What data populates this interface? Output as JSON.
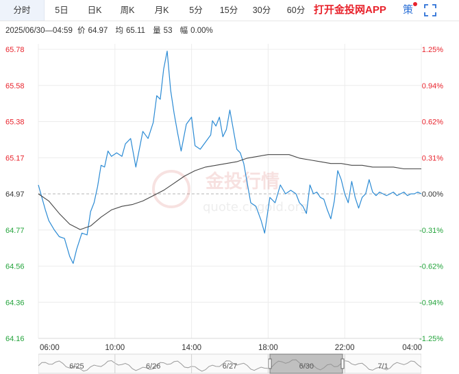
{
  "tabs": [
    "分时",
    "5日",
    "日K",
    "周K",
    "月K",
    "5分",
    "15分",
    "30分",
    "60分"
  ],
  "active_tab": "分时",
  "promo_text": "打开金投网APP",
  "strategy_label": "策",
  "info": {
    "datetime": "2025/06/30—04:59",
    "price_label": "价",
    "price": "64.97",
    "avg_label": "均",
    "avg": "65.11",
    "vol_label": "量",
    "vol": "53",
    "chg_label": "幅",
    "chg": "0.00%"
  },
  "watermark": {
    "text": "金投行情",
    "url": "quote.cngold.org"
  },
  "colors": {
    "up": "#e8222b",
    "down": "#22a33a",
    "flat": "#333333",
    "price_line": "#2a8ad4",
    "avg_line": "#444444"
  },
  "chart_data": {
    "type": "line",
    "title": "",
    "x_ticks": [
      "06:00",
      "10:00",
      "14:00",
      "18:00",
      "22:00",
      "04:00"
    ],
    "y_left_ticks": [
      "65.78",
      "65.58",
      "65.38",
      "65.17",
      "64.97",
      "64.77",
      "64.56",
      "64.36",
      "64.16"
    ],
    "y_right_ticks": [
      "1.25%",
      "0.94%",
      "0.62%",
      "0.31%",
      "0.00%",
      "-0.31%",
      "-0.62%",
      "-0.94%",
      "-1.25%"
    ],
    "ylim": [
      64.16,
      65.78
    ],
    "xlim_hours": [
      0,
      22
    ],
    "prev_close": 64.97,
    "series": [
      {
        "name": "价",
        "x": [
          0,
          0.2,
          0.4,
          0.6,
          0.9,
          1.2,
          1.5,
          1.8,
          2.0,
          2.2,
          2.5,
          2.8,
          3.0,
          3.2,
          3.4,
          3.6,
          3.8,
          4.0,
          4.2,
          4.5,
          4.8,
          5.0,
          5.3,
          5.6,
          6.0,
          6.3,
          6.6,
          6.8,
          7.0,
          7.2,
          7.4,
          7.6,
          7.8,
          8.0,
          8.2,
          8.5,
          8.8,
          9.0,
          9.3,
          9.6,
          9.9,
          10.0,
          10.2,
          10.4,
          10.6,
          10.8,
          11.0,
          11.2,
          11.4,
          11.6,
          11.8,
          12.0,
          12.2,
          12.5,
          12.8,
          13.0,
          13.3,
          13.6,
          13.9,
          14.2,
          14.5,
          14.8,
          15.0,
          15.2,
          15.4,
          15.6,
          15.8,
          16.0,
          16.2,
          16.4,
          16.6,
          16.8,
          17.0,
          17.2,
          17.4,
          17.6,
          17.8,
          18.0,
          18.2,
          18.4,
          18.6,
          18.8,
          19.0,
          19.2,
          19.4,
          19.6,
          19.8,
          20.0,
          20.2,
          20.4,
          20.6,
          20.8,
          21.0,
          21.2,
          21.4,
          21.6,
          21.8,
          22.0
        ],
        "values": [
          65.02,
          64.95,
          64.88,
          64.82,
          64.77,
          64.73,
          64.72,
          64.62,
          64.58,
          64.66,
          64.75,
          64.74,
          64.87,
          64.92,
          65.01,
          65.13,
          65.12,
          65.21,
          65.18,
          65.2,
          65.18,
          65.25,
          65.28,
          65.12,
          65.32,
          65.28,
          65.37,
          65.52,
          65.5,
          65.67,
          65.77,
          65.55,
          65.42,
          65.31,
          65.21,
          65.36,
          65.4,
          65.24,
          65.22,
          65.26,
          65.3,
          65.38,
          65.35,
          65.4,
          65.29,
          65.33,
          65.44,
          65.33,
          65.22,
          65.2,
          65.14,
          65.03,
          64.92,
          64.9,
          64.82,
          64.75,
          64.95,
          64.92,
          65.02,
          64.97,
          64.99,
          64.97,
          64.92,
          64.9,
          64.86,
          65.02,
          64.97,
          64.98,
          64.95,
          64.94,
          64.88,
          64.83,
          64.93,
          65.1,
          65.05,
          64.97,
          64.92,
          65.04,
          64.95,
          64.89,
          64.95,
          64.97,
          65.05,
          64.98,
          64.96,
          64.98,
          64.97,
          64.96,
          64.97,
          64.98,
          64.96,
          64.97,
          64.98,
          64.96,
          64.97,
          64.97,
          64.98,
          64.97
        ]
      },
      {
        "name": "均",
        "x": [
          0,
          0.6,
          1.2,
          1.8,
          2.4,
          3.0,
          3.6,
          4.2,
          4.8,
          5.4,
          6.0,
          6.6,
          7.2,
          7.8,
          8.4,
          9.0,
          9.6,
          10.2,
          10.8,
          11.4,
          12.0,
          12.6,
          13.2,
          13.8,
          14.4,
          15.0,
          15.6,
          16.2,
          16.8,
          17.4,
          18.0,
          18.6,
          19.2,
          19.8,
          20.4,
          21.0,
          21.6,
          22.0
        ],
        "values": [
          64.97,
          64.93,
          64.86,
          64.8,
          64.77,
          64.79,
          64.84,
          64.88,
          64.9,
          64.91,
          64.93,
          64.96,
          64.99,
          65.03,
          65.07,
          65.1,
          65.12,
          65.13,
          65.14,
          65.15,
          65.17,
          65.18,
          65.19,
          65.19,
          65.19,
          65.17,
          65.16,
          65.15,
          65.14,
          65.14,
          65.13,
          65.13,
          65.12,
          65.12,
          65.12,
          65.11,
          65.11,
          65.11
        ]
      }
    ],
    "navigator_labels": [
      "6/25",
      "6/26",
      "6/27",
      "6/30",
      "7/1"
    ],
    "grid": true
  }
}
